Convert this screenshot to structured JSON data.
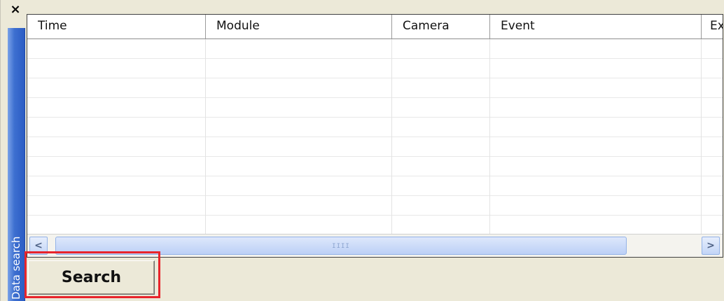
{
  "panel": {
    "side_tab_label": "Data search",
    "close_glyph": "×"
  },
  "table": {
    "columns": [
      "Time",
      "Module",
      "Camera",
      "Event",
      "Ex"
    ],
    "row_count": 10
  },
  "scrollbar": {
    "left_arrow": "<",
    "right_arrow": ">",
    "grip": "IIII"
  },
  "actions": {
    "search_label": "Search"
  },
  "colors": {
    "side_tab": "#2b5cc4",
    "highlight": "#e8242b",
    "scroll_thumb": "#c3d5f7"
  }
}
